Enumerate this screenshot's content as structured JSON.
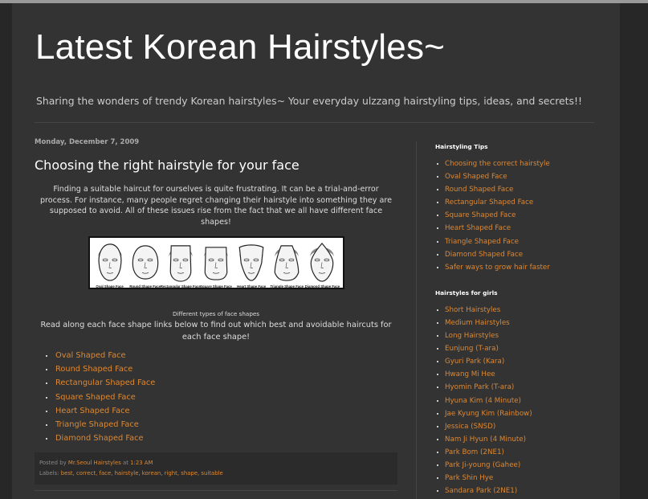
{
  "header": {
    "title": "Latest Korean Hairstyles~",
    "description": "Sharing the wonders of trendy Korean hairstyles~ Your everyday ulzzang hairstyling tips, ideas, and secrets!!"
  },
  "post": {
    "date": "Monday, December 7, 2009",
    "title": "Choosing the right hairstyle for your face",
    "body": "Finding a suitable haircut for ourselves is quite frustrating. It can be a trial-and-error process. For instance, many people regret changing their hairstyle into something they are supposed to avoid. All of these issues rise from the fact that we all have different face shapes!",
    "figure_labels": [
      "Oval Shape Face",
      "Round Shape Face",
      "Rectangular Shape Face",
      "Square Shape Face",
      "Heart Shape Face",
      "Triangle Shape Face",
      "Diamond Shape Face"
    ],
    "caption": "Different types of face shapes",
    "intro": "Read along each face shape links below to find out which best and avoidable haircuts for each face shape!",
    "links": [
      "Oval Shaped Face",
      "Round Shaped Face",
      "Rectangular Shaped Face",
      "Square Shaped Face",
      "Heart Shaped Face",
      "Triangle Shaped Face",
      "Diamond Shaped Face"
    ],
    "footer": {
      "posted_by": "Posted by",
      "author": "Mr.Seoul Hairstyles",
      "at": "at",
      "time": "1:23 AM",
      "labels_prefix": "Labels:",
      "labels": "best, correct, face, hairstyle, korean, right, shape, suitable"
    }
  },
  "sidebar": {
    "tips": {
      "title": "Hairstyling Tips",
      "items": [
        "Choosing the correct hairstyle",
        "Oval Shaped Face",
        "Round Shaped Face",
        "Rectangular Shaped Face",
        "Square Shaped Face",
        "Heart Shaped Face",
        "Triangle Shaped Face",
        "Diamond Shaped Face",
        "Safer ways to grow hair faster"
      ]
    },
    "girls": {
      "title": "Hairstyles for girls",
      "items": [
        "Short Hairstyles",
        "Medium Hairstyles",
        "Long Hairstyles",
        "Eunjung (T-ara)",
        "Gyuri Park (Kara)",
        "Hwang Mi Hee",
        "Hyomin Park (T-ara)",
        "Hyuna Kim (4 Minute)",
        "Jae Kyung Kim (Rainbow)",
        "Jessica (SNSD)",
        "Nam Ji Hyun (4 Minute)",
        "Park Bom (2NE1)",
        "Park Ji-young (Gahee)",
        "Park Shin Hye",
        "Sandara Park (2NE1)"
      ]
    }
  },
  "colors": {
    "background": "#272727",
    "content": "#333333",
    "link": "#dd8833",
    "title": "#ffffff"
  }
}
